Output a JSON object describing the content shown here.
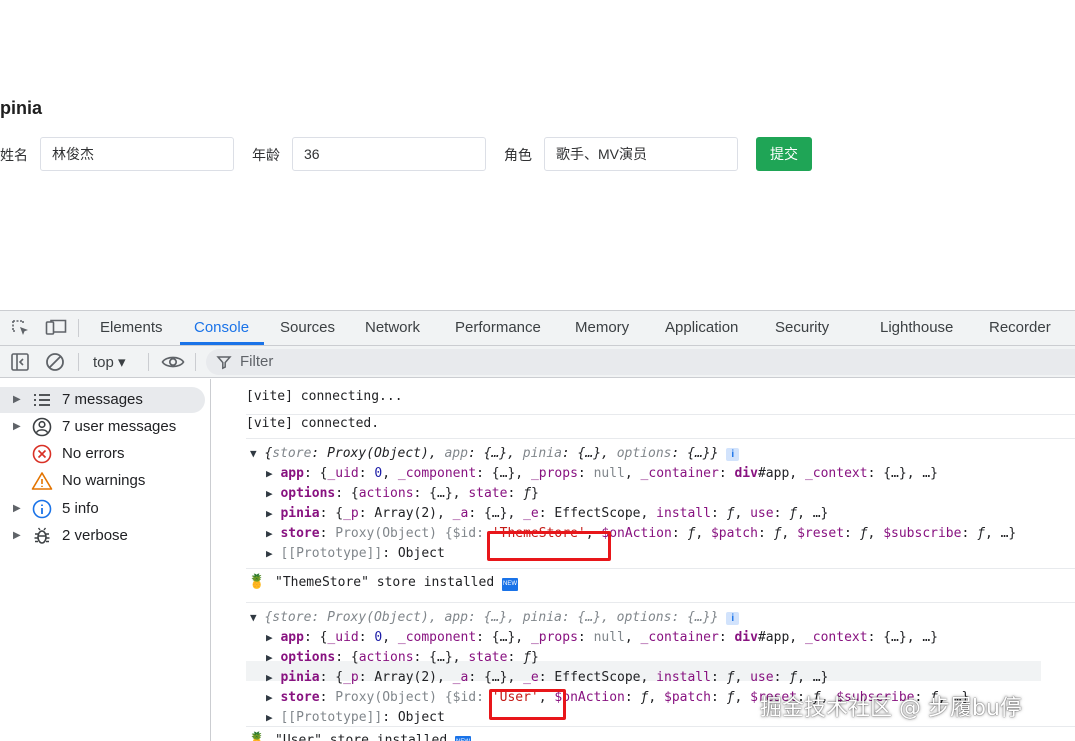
{
  "page": {
    "title": "pinia",
    "form": {
      "name_label": "姓名",
      "name_value": "林俊杰",
      "age_label": "年龄",
      "age_value": "36",
      "role_label": "角色",
      "role_value": "歌手、MV演员",
      "submit_label": "提交"
    }
  },
  "devtools": {
    "tabs": [
      "Elements",
      "Console",
      "Sources",
      "Network",
      "Performance",
      "Memory",
      "Application",
      "Security",
      "Lighthouse",
      "Recorder"
    ],
    "active_tab": "Console",
    "toolbar": {
      "context": "top ▾",
      "filter_placeholder": "Filter"
    },
    "sidebar": [
      {
        "label": "7 messages",
        "icon": "list-icon",
        "expandable": true
      },
      {
        "label": "7 user messages",
        "icon": "user-icon",
        "expandable": true
      },
      {
        "label": "No errors",
        "icon": "error-icon",
        "expandable": false
      },
      {
        "label": "No warnings",
        "icon": "warning-icon",
        "expandable": false
      },
      {
        "label": "5 info",
        "icon": "info-icon",
        "expandable": true
      },
      {
        "label": "2 verbose",
        "icon": "bug-icon",
        "expandable": true
      }
    ],
    "console": {
      "line1": "[vite] connecting...",
      "line2": "[vite] connected.",
      "theme_installed": "\"ThemeStore\" store installed",
      "user_installed": "\"User\" store installed",
      "obj1_store_id": "'ThemeStore'",
      "obj2_store_id": "'User'",
      "info_badge": "i",
      "new_badge": "NEW"
    }
  },
  "colors": {
    "accent": "#1a73e8",
    "submit": "#1fa556",
    "highlight": "#e8161a"
  },
  "watermark": "掘金技术社区 @ 步履bu停"
}
